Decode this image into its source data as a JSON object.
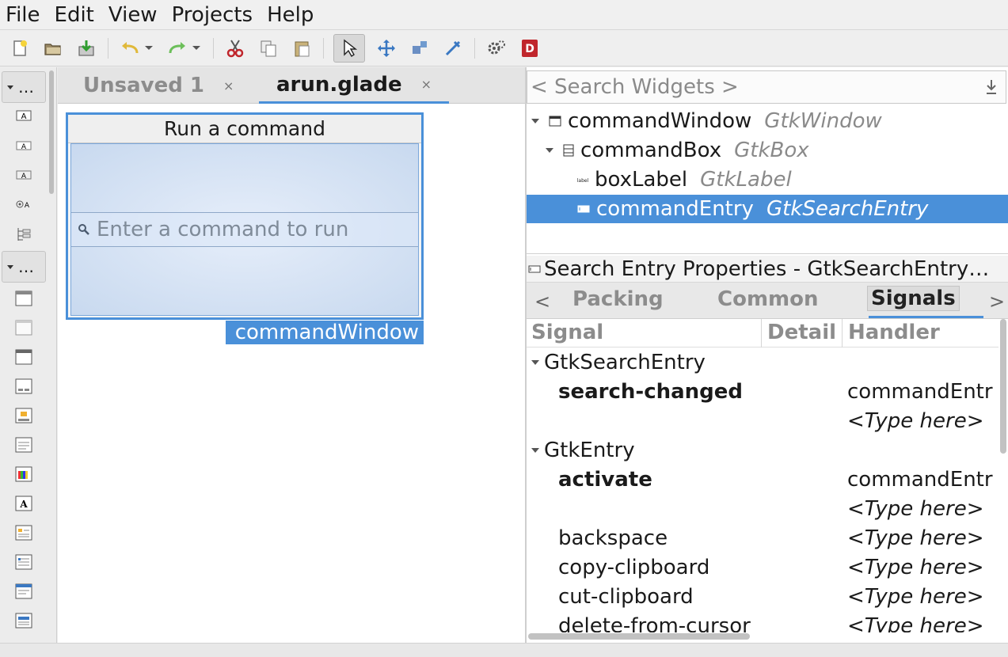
{
  "menu": [
    "File",
    "Edit",
    "View",
    "Projects",
    "Help"
  ],
  "palette": {
    "group1_label": "…",
    "group2_label": "…"
  },
  "tabs": [
    {
      "label": "Unsaved 1",
      "close": "×"
    },
    {
      "label": "arun.glade",
      "close": "×"
    }
  ],
  "design": {
    "window_title": "Run a command",
    "entry_placeholder": "Enter a command to run",
    "selected_label": "commandWindow"
  },
  "search": {
    "placeholder": "< Search Widgets >"
  },
  "tree": [
    {
      "name": "commandWindow",
      "type": "GtkWindow"
    },
    {
      "name": "commandBox",
      "type": "GtkBox"
    },
    {
      "name": "boxLabel",
      "type": "GtkLabel",
      "icon_text": "label"
    },
    {
      "name": "commandEntry",
      "type": "GtkSearchEntry"
    }
  ],
  "properties": {
    "title": "Search Entry Properties - GtkSearchEntry…",
    "tabs": [
      "Packing",
      "Common",
      "Signals"
    ],
    "prev": "<",
    "next": ">"
  },
  "signals": {
    "headers": [
      "Signal",
      "Detail",
      "Handler"
    ],
    "groups": [
      "GtkSearchEntry",
      "GtkEntry"
    ],
    "rows": [
      {
        "signal": "search-changed",
        "handler": "commandEntr"
      },
      {
        "signal": "",
        "handler": "<Type here>"
      },
      {
        "signal": "activate",
        "handler": "commandEntr"
      },
      {
        "signal": "",
        "handler": "<Type here>"
      },
      {
        "signal": "backspace",
        "handler": "<Type here>"
      },
      {
        "signal": "copy-clipboard",
        "handler": "<Type here>"
      },
      {
        "signal": "cut-clipboard",
        "handler": "<Type here>"
      },
      {
        "signal": "delete-from-cursor",
        "handler": "<Type here>"
      }
    ]
  },
  "colors": {
    "accent": "#4a90d9"
  }
}
